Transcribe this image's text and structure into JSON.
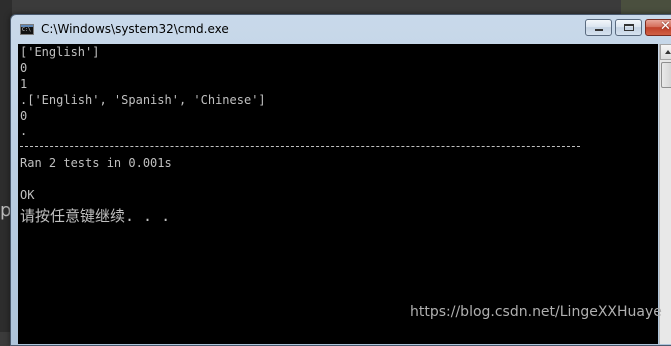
{
  "background": {
    "left_partial_text": "p"
  },
  "window": {
    "title": "C:\\Windows\\system32\\cmd.exe",
    "icon": "cmd-console-icon"
  },
  "controls": {
    "minimize_icon": "minimize-icon",
    "maximize_icon": "maximize-icon",
    "close_icon": "close-icon",
    "close_glyph": "✕"
  },
  "console": {
    "lines": [
      "['English']",
      "0",
      "1",
      ".['English', 'Spanish', 'Chinese']",
      "0",
      ".",
      "Ran 2 tests in 0.001s",
      "OK"
    ],
    "separator": "----------------------------------------------------------------------",
    "prompt": "请按任意键继续. . ."
  },
  "watermark": "https://blog.csdn.net/LingeXXHuaye",
  "colors": {
    "console_bg": "#000000",
    "console_fg": "#c0c0c0",
    "close_button": "#c1412a",
    "titlebar": "#c9d9ea"
  }
}
